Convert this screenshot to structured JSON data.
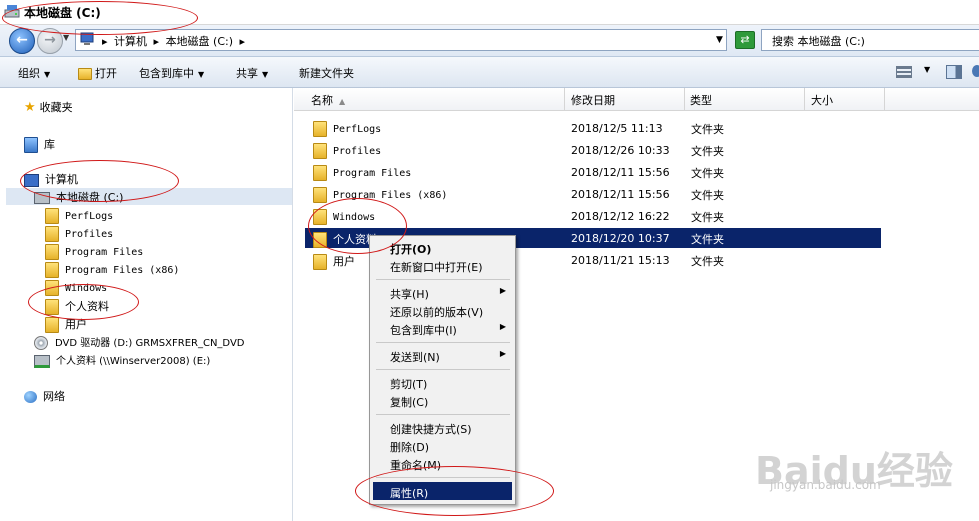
{
  "window": {
    "title": "本地磁盘 (C:)"
  },
  "address": {
    "crumbs": [
      "计算机",
      "▸",
      "本地磁盘 (C:)",
      "▸"
    ],
    "search_placeholder": "搜索 本地磁盘 (C:)"
  },
  "toolbar": {
    "organize": "组织",
    "open": "打开",
    "include_in_library": "包含到库中",
    "share": "共享",
    "new_folder": "新建文件夹"
  },
  "nav": {
    "favorites": "收藏夹",
    "libraries": "库",
    "computer": "计算机",
    "local_disk": "本地磁盘 (C:)",
    "folders": [
      "PerfLogs",
      "Profiles",
      "Program Files",
      "Program Files (x86)",
      "Windows",
      "个人资料",
      "用户"
    ],
    "dvd": "DVD 驱动器 (D:) GRMSXFRER_CN_DVD",
    "network_drive": "个人资料 (\\\\Winserver2008) (E:)",
    "network": "网络"
  },
  "columns": {
    "name": "名称",
    "modified": "修改日期",
    "type": "类型",
    "size": "大小"
  },
  "files": [
    {
      "name": "PerfLogs",
      "modified": "2018/12/5 11:13",
      "type": "文件夹"
    },
    {
      "name": "Profiles",
      "modified": "2018/12/26 10:33",
      "type": "文件夹"
    },
    {
      "name": "Program Files",
      "modified": "2018/12/11 15:56",
      "type": "文件夹"
    },
    {
      "name": "Program Files (x86)",
      "modified": "2018/12/11 15:56",
      "type": "文件夹"
    },
    {
      "name": "Windows",
      "modified": "2018/12/12 16:22",
      "type": "文件夹"
    },
    {
      "name": "个人资料",
      "modified": "2018/12/20 10:37",
      "type": "文件夹"
    },
    {
      "name": "用户",
      "modified": "2018/11/21 15:13",
      "type": "文件夹"
    }
  ],
  "context_menu": {
    "open": "打开(O)",
    "open_new_window": "在新窗口中打开(E)",
    "share": "共享(H)",
    "restore_versions": "还原以前的版本(V)",
    "include_library": "包含到库中(I)",
    "send_to": "发送到(N)",
    "cut": "剪切(T)",
    "copy": "复制(C)",
    "create_shortcut": "创建快捷方式(S)",
    "delete": "删除(D)",
    "rename": "重命名(M)",
    "properties": "属性(R)"
  },
  "watermark": {
    "main": "Baidu经验",
    "sub": "jingyan.baidu.com"
  },
  "colors": {
    "selection": "#0a246a",
    "annotation": "#d01818"
  }
}
